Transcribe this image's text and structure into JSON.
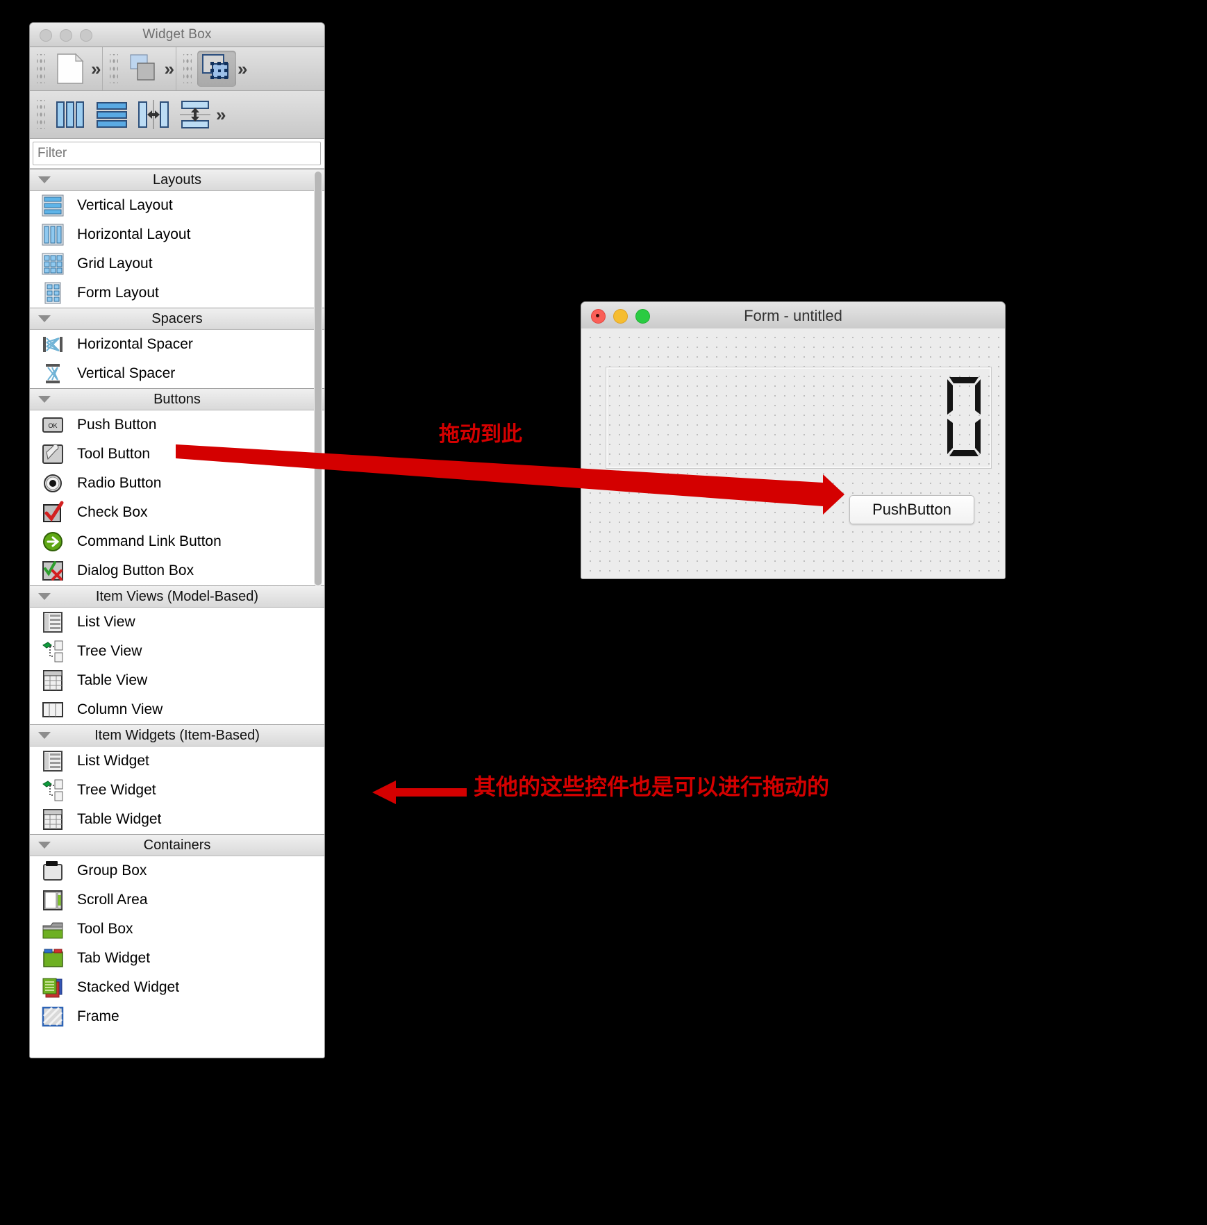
{
  "widget_box": {
    "title": "Widget Box",
    "window_dots": [
      "minimize-dot",
      "zoom-dot",
      "close-dot"
    ],
    "toolbar_row1": [
      {
        "name": "new-form-icon",
        "selected": false
      },
      {
        "name": "chevron-double-right-icon",
        "selected": false
      },
      {
        "name": "stacked-widgets-icon",
        "selected": false
      },
      {
        "name": "chevron-double-right-icon",
        "selected": false
      },
      {
        "name": "edit-widgets-icon",
        "selected": true
      }
    ],
    "toolbar_row2": [
      {
        "name": "horizontal-layout-icon",
        "selected": false
      },
      {
        "name": "vertical-layout-icon",
        "selected": false
      },
      {
        "name": "break-layout-horizontal-icon",
        "selected": false
      },
      {
        "name": "adjust-size-icon",
        "selected": false
      },
      {
        "name": "chevron-double-right-icon",
        "selected": false
      }
    ],
    "filter": {
      "value": "",
      "placeholder": "Filter"
    },
    "categories": [
      {
        "label": "Layouts",
        "expanded": true,
        "items": [
          {
            "label": "Vertical Layout",
            "icon": "vertical-layout-icon"
          },
          {
            "label": "Horizontal Layout",
            "icon": "horizontal-layout-icon"
          },
          {
            "label": "Grid Layout",
            "icon": "grid-layout-icon"
          },
          {
            "label": "Form Layout",
            "icon": "form-layout-icon"
          }
        ]
      },
      {
        "label": "Spacers",
        "expanded": true,
        "items": [
          {
            "label": "Horizontal Spacer",
            "icon": "horizontal-spacer-icon"
          },
          {
            "label": "Vertical Spacer",
            "icon": "vertical-spacer-icon"
          }
        ]
      },
      {
        "label": "Buttons",
        "expanded": true,
        "items": [
          {
            "label": "Push Button",
            "icon": "push-button-icon"
          },
          {
            "label": "Tool Button",
            "icon": "tool-button-icon"
          },
          {
            "label": "Radio Button",
            "icon": "radio-button-icon"
          },
          {
            "label": "Check Box",
            "icon": "check-box-icon"
          },
          {
            "label": "Command Link Button",
            "icon": "command-link-button-icon"
          },
          {
            "label": "Dialog Button Box",
            "icon": "dialog-button-box-icon"
          }
        ]
      },
      {
        "label": "Item Views (Model-Based)",
        "expanded": true,
        "items": [
          {
            "label": "List View",
            "icon": "list-view-icon"
          },
          {
            "label": "Tree View",
            "icon": "tree-view-icon"
          },
          {
            "label": "Table View",
            "icon": "table-view-icon"
          },
          {
            "label": "Column View",
            "icon": "column-view-icon"
          }
        ]
      },
      {
        "label": "Item Widgets (Item-Based)",
        "expanded": true,
        "items": [
          {
            "label": "List Widget",
            "icon": "list-widget-icon"
          },
          {
            "label": "Tree Widget",
            "icon": "tree-widget-icon"
          },
          {
            "label": "Table Widget",
            "icon": "table-widget-icon"
          }
        ]
      },
      {
        "label": "Containers",
        "expanded": true,
        "items": [
          {
            "label": "Group Box",
            "icon": "group-box-icon"
          },
          {
            "label": "Scroll Area",
            "icon": "scroll-area-icon"
          },
          {
            "label": "Tool Box",
            "icon": "tool-box-icon"
          },
          {
            "label": "Tab Widget",
            "icon": "tab-widget-icon"
          },
          {
            "label": "Stacked Widget",
            "icon": "stacked-widget-icon"
          },
          {
            "label": "Frame",
            "icon": "frame-icon"
          }
        ]
      }
    ]
  },
  "form_window": {
    "title": "Form - untitled",
    "lcd_value": "0",
    "push_button_label": "PushButton"
  },
  "annotations": [
    {
      "name": "drag-here-note",
      "text": "拖动到此",
      "color": "#d40000"
    },
    {
      "name": "other-widgets-draggable-note",
      "text": "其他的这些控件也是可以进行拖动的",
      "color": "#d40000"
    }
  ],
  "colors": {
    "annotation_red": "#d40000",
    "window_bg": "#ececec",
    "selected_toolbar": "#b0b0b0"
  }
}
